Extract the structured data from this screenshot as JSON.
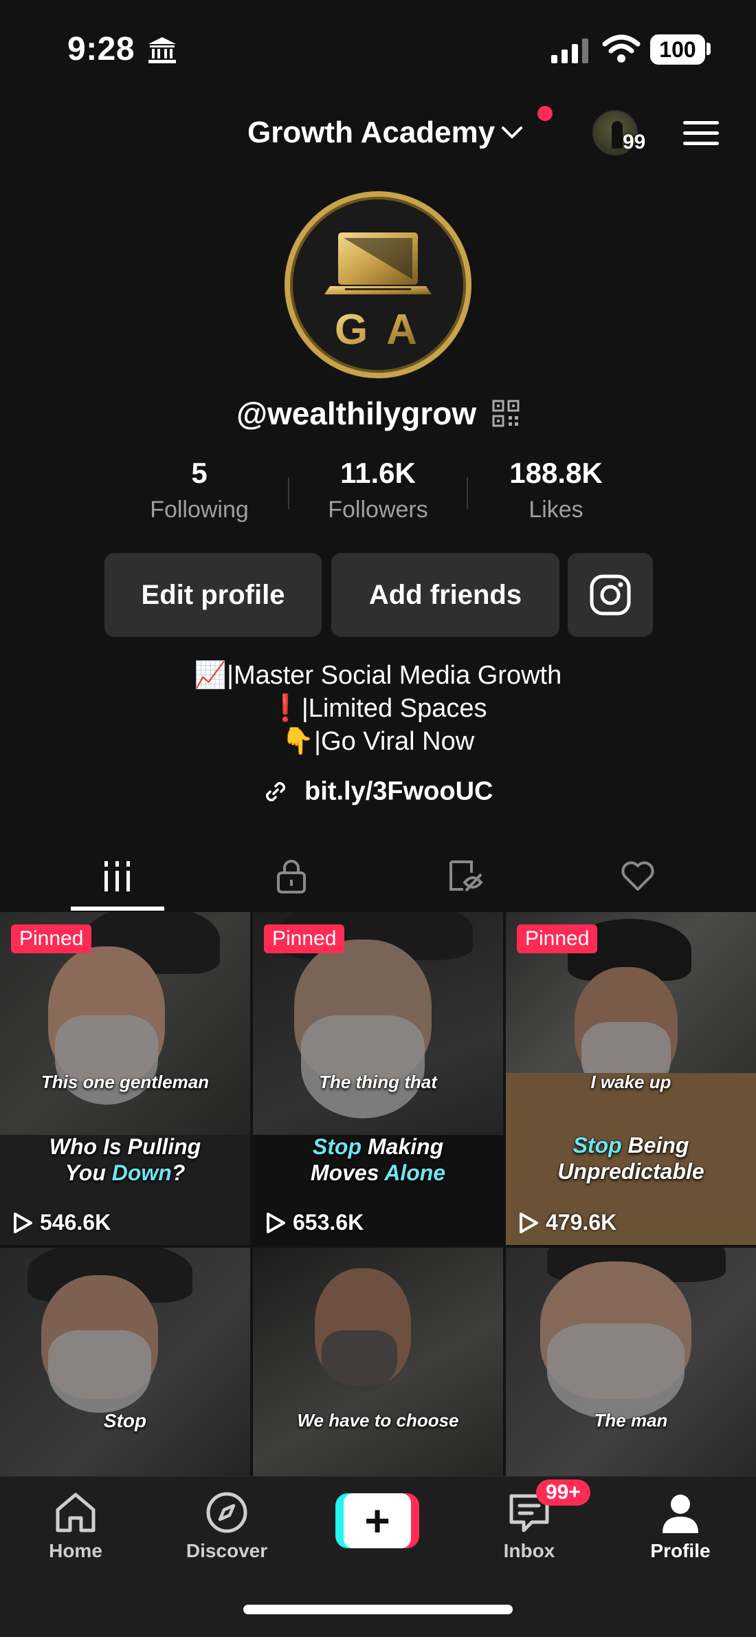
{
  "status_bar": {
    "time": "9:28",
    "battery": "100"
  },
  "header": {
    "account_name": "Growth Academy",
    "avatar_count": "99"
  },
  "profile": {
    "avatar_logo_text": "G A",
    "username": "@wealthilygrow",
    "stats": [
      {
        "value": "5",
        "label": "Following"
      },
      {
        "value": "11.6K",
        "label": "Followers"
      },
      {
        "value": "188.8K",
        "label": "Likes"
      }
    ],
    "buttons": {
      "edit": "Edit profile",
      "add_friends": "Add friends"
    },
    "bio": [
      "📈|Master Social Media Growth",
      "❗️|Limited Spaces",
      "👇|Go Viral Now"
    ],
    "link": "bit.ly/3FwooUC"
  },
  "tabs": [
    "videos-grid-icon",
    "private-lock-icon",
    "reposts-icon",
    "liked-heart-icon"
  ],
  "videos": [
    {
      "pinned": "Pinned",
      "small": "This one gentleman",
      "big1": "Who Is Pulling",
      "big2a": "You ",
      "big2b": "Down",
      "big2c": "?",
      "views": "546.6K"
    },
    {
      "pinned": "Pinned",
      "small": "The thing that",
      "big1a": "Stop",
      "big1b": " Making",
      "big2a": "Moves ",
      "big2b": "Alone",
      "views": "653.6K"
    },
    {
      "pinned": "Pinned",
      "small": "I wake up",
      "big1a": "Stop",
      "big1b": " Being",
      "big2": "Unpredictable",
      "views": "479.6K"
    },
    {
      "small": "Stop"
    },
    {
      "small": "We have to choose"
    },
    {
      "small": "The man"
    }
  ],
  "bottom_nav": {
    "home": "Home",
    "discover": "Discover",
    "inbox": "Inbox",
    "inbox_badge": "99+",
    "profile": "Profile"
  },
  "colors": {
    "accent": "#fe2c55",
    "cyan": "#25f4ee",
    "gold": "#c9a24a",
    "caption_highlight": "#6ee6f0"
  }
}
